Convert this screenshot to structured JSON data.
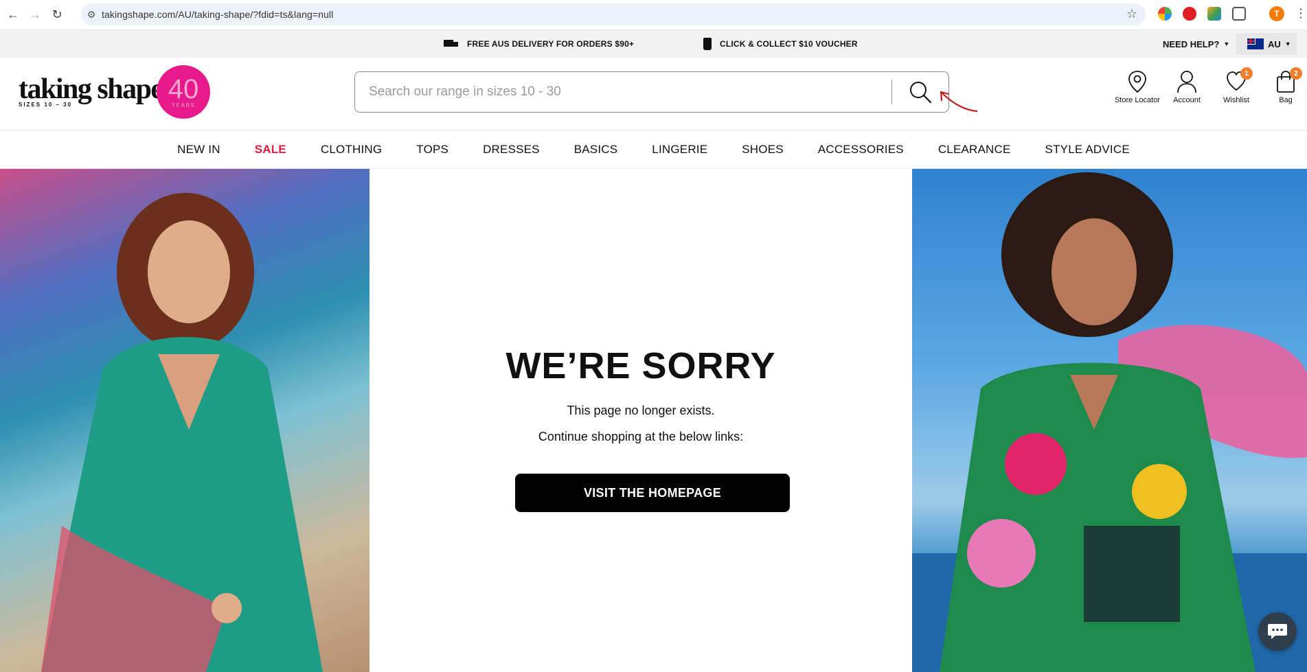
{
  "browser": {
    "url": "takingshape.com/AU/taking-shape/?fdid=ts&lang=null",
    "profile_initial": "T"
  },
  "promo": {
    "delivery": "FREE AUS DELIVERY FOR ORDERS $90+",
    "collect": "CLICK & COLLECT $10 VOUCHER",
    "help": "NEED HELP?",
    "region": "AU"
  },
  "header": {
    "logo_text": "taking shape",
    "logo_sub": "SIZES 10 – 30",
    "badge_num": "40",
    "badge_sub": "YEARS",
    "search_placeholder": "Search our range in sizes 10 - 30",
    "icons": {
      "store": "Store Locator",
      "account": "Account",
      "wishlist": "Wishlist",
      "wishlist_count": "1",
      "bag": "Bag",
      "bag_count": "2"
    }
  },
  "nav": [
    "NEW IN",
    "SALE",
    "CLOTHING",
    "TOPS",
    "DRESSES",
    "BASICS",
    "LINGERIE",
    "SHOES",
    "ACCESSORIES",
    "CLEARANCE",
    "STYLE ADVICE"
  ],
  "main": {
    "title": "WE’RE SORRY",
    "line1": "This page no longer exists.",
    "line2": "Continue shopping at the below links:",
    "button": "VISIT THE HOMEPAGE"
  },
  "colors": {
    "sale": "#e41b3a",
    "badge": "#e8198b",
    "count": "#f07e2c",
    "button": "#000000"
  }
}
